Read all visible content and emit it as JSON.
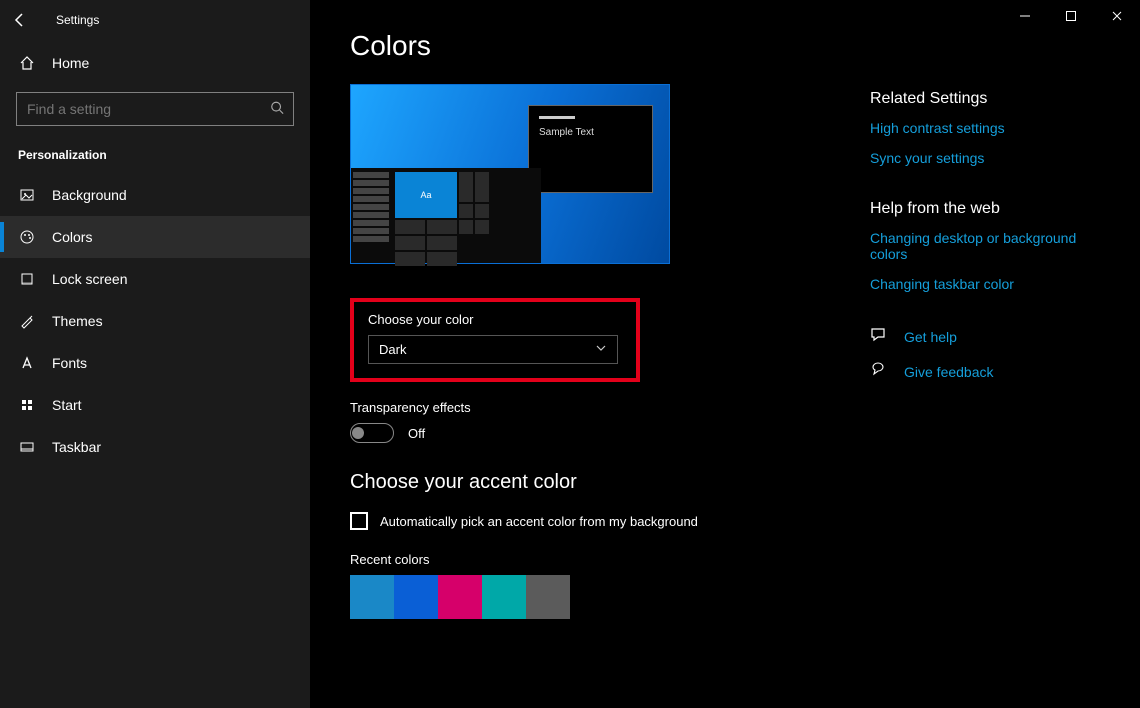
{
  "window": {
    "title": "Settings"
  },
  "sidebar": {
    "home": "Home",
    "search_placeholder": "Find a setting",
    "section": "Personalization",
    "items": [
      {
        "label": "Background",
        "icon": "image-icon"
      },
      {
        "label": "Colors",
        "icon": "palette-icon"
      },
      {
        "label": "Lock screen",
        "icon": "lock-icon"
      },
      {
        "label": "Themes",
        "icon": "brush-icon"
      },
      {
        "label": "Fonts",
        "icon": "font-icon"
      },
      {
        "label": "Start",
        "icon": "start-icon"
      },
      {
        "label": "Taskbar",
        "icon": "taskbar-icon"
      }
    ],
    "active_index": 1
  },
  "page": {
    "title": "Colors",
    "preview_sample_text": "Sample Text",
    "preview_tile_label": "Aa",
    "choose_color_label": "Choose your color",
    "choose_color_value": "Dark",
    "transparency_label": "Transparency effects",
    "transparency_state": "Off",
    "accent_title": "Choose your accent color",
    "auto_pick_label": "Automatically pick an accent color from my background",
    "recent_label": "Recent colors",
    "recent_colors": [
      "#1a88c7",
      "#0a5fd6",
      "#d6006a",
      "#00a8a8",
      "#5b5b5b"
    ]
  },
  "aside": {
    "related_title": "Related Settings",
    "related_links": [
      "High contrast settings",
      "Sync your settings"
    ],
    "help_title": "Help from the web",
    "help_links": [
      "Changing desktop or background colors",
      "Changing taskbar color"
    ],
    "get_help": "Get help",
    "give_feedback": "Give feedback"
  }
}
